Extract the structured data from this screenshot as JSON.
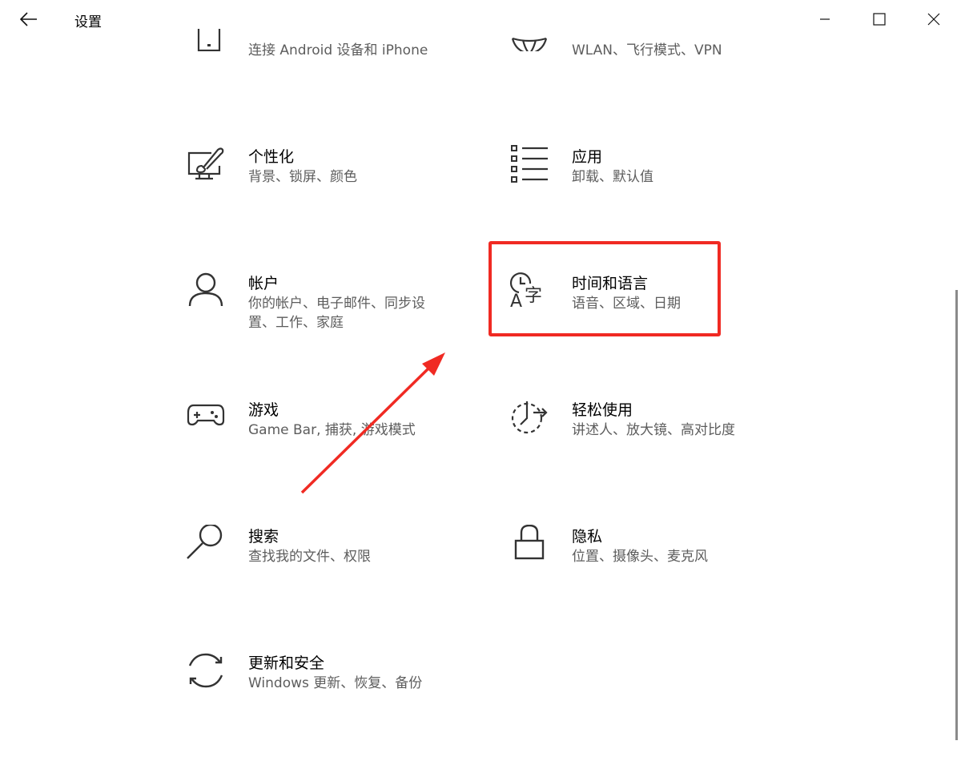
{
  "window": {
    "title": "设置"
  },
  "tiles": [
    {
      "title": "",
      "desc": "连接 Android 设备和 iPhone",
      "icon": "phone-icon"
    },
    {
      "title": "",
      "desc": "WLAN、飞行模式、VPN",
      "icon": "globe-icon"
    },
    {
      "title": "个性化",
      "desc": "背景、锁屏、颜色",
      "icon": "personalization-icon"
    },
    {
      "title": "应用",
      "desc": "卸载、默认值",
      "icon": "apps-list-icon"
    },
    {
      "title": "帐户",
      "desc": "你的帐户、电子邮件、同步设置、工作、家庭",
      "icon": "account-icon"
    },
    {
      "title": "时间和语言",
      "desc": "语音、区域、日期",
      "icon": "time-language-icon"
    },
    {
      "title": "游戏",
      "desc": "Game Bar, 捕获, 游戏模式",
      "icon": "gamepad-icon"
    },
    {
      "title": "轻松使用",
      "desc": "讲述人、放大镜、高对比度",
      "icon": "ease-of-access-icon"
    },
    {
      "title": "搜索",
      "desc": "查找我的文件、权限",
      "icon": "search-icon"
    },
    {
      "title": "隐私",
      "desc": "位置、摄像头、麦克风",
      "icon": "lock-icon"
    },
    {
      "title": "更新和安全",
      "desc": "Windows 更新、恢复、备份",
      "icon": "sync-icon"
    }
  ],
  "annotation": {
    "highlight_color": "#f02a23"
  }
}
